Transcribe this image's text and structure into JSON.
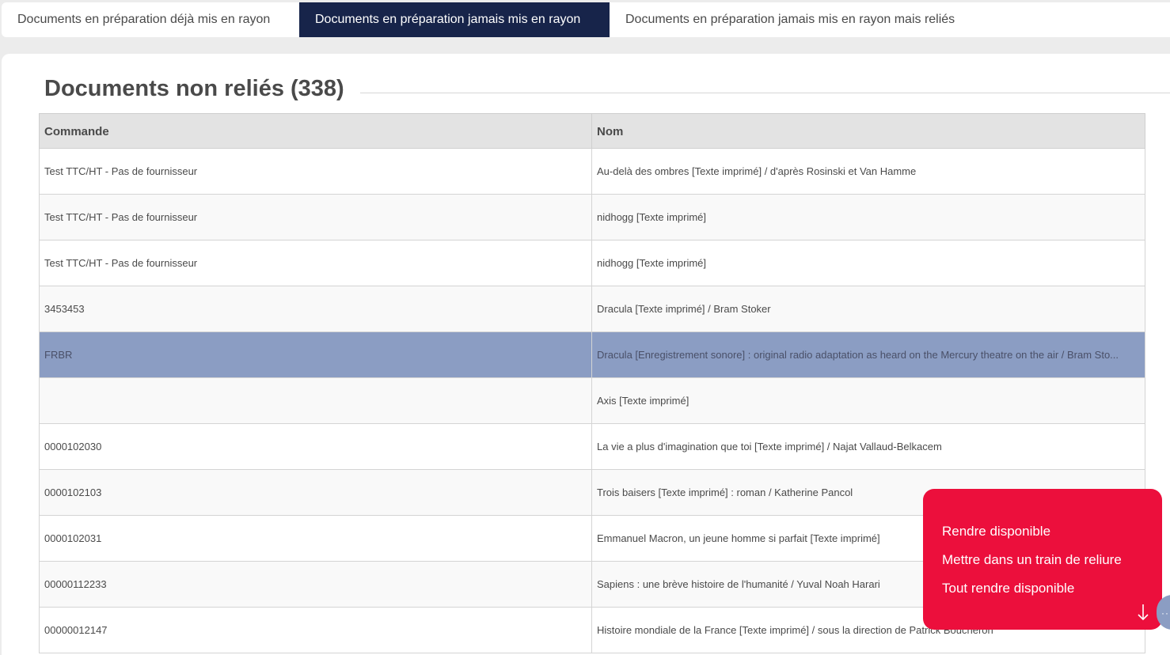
{
  "tabs": [
    {
      "label": "Documents en préparation déjà mis en rayon",
      "active": false
    },
    {
      "label": "Documents en préparation jamais mis en rayon",
      "active": true
    },
    {
      "label": "Documents en préparation jamais mis en rayon mais reliés",
      "active": false
    }
  ],
  "section": {
    "title": "Documents non reliés (338)"
  },
  "table": {
    "columns": [
      "Commande",
      "Nom"
    ],
    "rows": [
      {
        "commande": "Test TTC/HT - Pas de fournisseur",
        "nom": "Au-delà des ombres [Texte imprimé] / d'après Rosinski et Van Hamme"
      },
      {
        "commande": "Test TTC/HT - Pas de fournisseur",
        "nom": "nidhogg [Texte imprimé]"
      },
      {
        "commande": "Test TTC/HT - Pas de fournisseur",
        "nom": "nidhogg [Texte imprimé]"
      },
      {
        "commande": "3453453",
        "nom": "Dracula [Texte imprimé] / Bram Stoker"
      },
      {
        "commande": "FRBR",
        "nom": "Dracula [Enregistrement sonore] : original radio adaptation as heard on the Mercury theatre on the air / Bram Sto..."
      },
      {
        "commande": "",
        "nom": "Axis [Texte imprimé]"
      },
      {
        "commande": "0000102030",
        "nom": "La vie a plus d'imagination que toi [Texte imprimé] / Najat Vallaud-Belkacem"
      },
      {
        "commande": "0000102103",
        "nom": "Trois baisers [Texte imprimé] : roman / Katherine Pancol"
      },
      {
        "commande": "0000102031",
        "nom": "Emmanuel Macron, un jeune homme si parfait [Texte imprimé]"
      },
      {
        "commande": "00000112233",
        "nom": "Sapiens : une brève histoire de l'humanité / Yuval Noah Harari"
      },
      {
        "commande": "00000012147",
        "nom": "Histoire mondiale de la France [Texte imprimé] / sous la direction de Patrick Boucheron"
      }
    ]
  },
  "action_menu": {
    "items": [
      "Rendre disponible",
      "Mettre dans un train de reliure",
      "Tout rendre disponible"
    ],
    "arrow_icon": "arrow-down-icon",
    "background": "#ec0f3c"
  },
  "colors": {
    "active_tab": "#17244a",
    "selected_row": "#8b9dc3"
  }
}
